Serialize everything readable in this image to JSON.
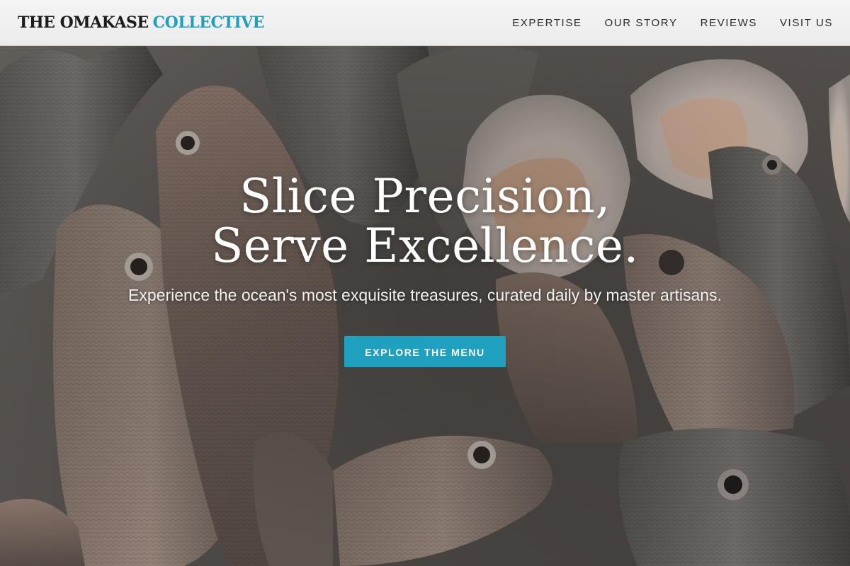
{
  "brand": {
    "name_part1": "THE OMAKASE",
    "name_part2": "COLLECTIVE",
    "accent_color": "#1fa0bf"
  },
  "nav": {
    "items": [
      {
        "label": "EXPERTISE"
      },
      {
        "label": "OUR STORY"
      },
      {
        "label": "REVIEWS"
      },
      {
        "label": "VISIT US"
      }
    ]
  },
  "hero": {
    "title_line1": "Slice Precision,",
    "title_line2": "Serve Excellence.",
    "subtitle": "Experience the ocean's most exquisite treasures, curated daily by master artisans.",
    "cta_label": "EXPLORE THE MENU",
    "background_image": "fresh-fish-on-ice-photo"
  }
}
